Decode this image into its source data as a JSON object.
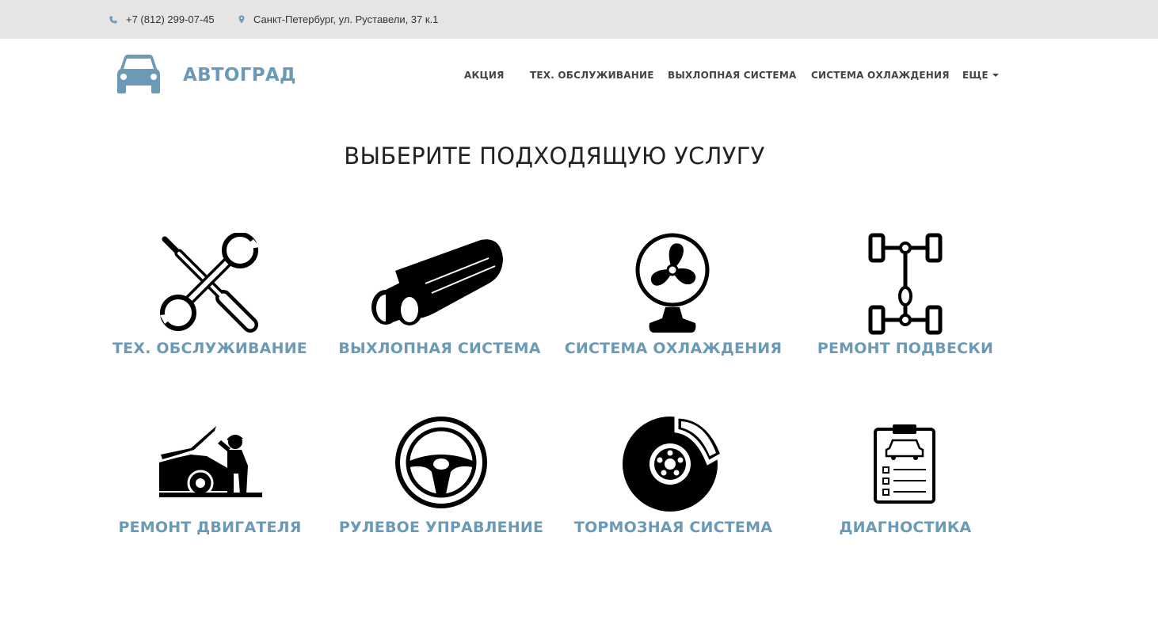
{
  "topbar": {
    "phone": "+7 (812) 299-07-45",
    "address": "Санкт-Петербург, ул. Руставели, 37 к.1"
  },
  "brand": {
    "name": "АВТОГРАД"
  },
  "nav": {
    "items": [
      "АКЦИЯ",
      "ТЕХ. ОБСЛУЖИВАНИЕ",
      "ВЫХЛОПНАЯ СИСТЕМА",
      "СИСТЕМА ОХЛАЖДЕНИЯ"
    ],
    "more": "ЕЩЕ"
  },
  "main": {
    "title": "ВЫБЕРИТЕ ПОДХОДЯЩУЮ УСЛУГУ",
    "services": [
      {
        "label": "ТЕХ. ОБСЛУЖИВАНИЕ",
        "icon": "wrench-screwdriver-icon"
      },
      {
        "label": "ВЫХЛОПНАЯ СИСТЕМА",
        "icon": "exhaust-muffler-icon"
      },
      {
        "label": "СИСТЕМА ОХЛАЖДЕНИЯ",
        "icon": "fan-icon"
      },
      {
        "label": "РЕМОНТ ПОДВЕСКИ",
        "icon": "suspension-chassis-icon"
      },
      {
        "label": "РЕМОНТ ДВИГАТЕЛЯ",
        "icon": "mechanic-car-icon"
      },
      {
        "label": "РУЛЕВОЕ УПРАВЛЕНИЕ",
        "icon": "steering-wheel-icon"
      },
      {
        "label": "ТОРМОЗНАЯ СИСТЕМА",
        "icon": "brake-disc-icon"
      },
      {
        "label": "ДИАГНОСТИКА",
        "icon": "diagnostics-clipboard-icon"
      }
    ]
  },
  "colors": {
    "accent": "#6a9ab5",
    "topbar_bg": "#e6e5e3",
    "text": "#222222"
  }
}
